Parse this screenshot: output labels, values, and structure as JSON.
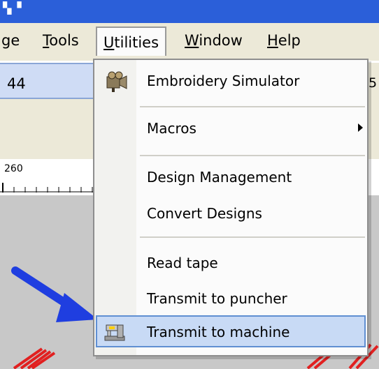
{
  "window": {
    "title_glyph": "▚▝"
  },
  "menubar": {
    "items": [
      {
        "label": "ge"
      },
      {
        "label": "Tools",
        "mnemonic": "T"
      },
      {
        "label": "Utilities",
        "mnemonic": "U",
        "open": true
      },
      {
        "label": "Window",
        "mnemonic": "W"
      },
      {
        "label": "Help",
        "mnemonic": "H"
      }
    ]
  },
  "toolbar": {
    "field_value": "44",
    "right_fragment": "5"
  },
  "ruler": {
    "number": "260"
  },
  "utilities_menu": {
    "items": [
      {
        "label": "Embroidery Simulator",
        "icon": "simulator-icon"
      },
      {
        "label": "Macros",
        "has_submenu": true
      },
      {
        "label": "Design Management"
      },
      {
        "label": "Convert Designs"
      },
      {
        "label": "Read tape"
      },
      {
        "label": "Transmit to puncher"
      },
      {
        "label": "Transmit to machine",
        "icon": "embroidery-machine-icon",
        "highlighted": true
      }
    ]
  },
  "colors": {
    "titlebar": "#2b5fd9",
    "menu_highlight": "#c8daf5",
    "highlight_border": "#5f8fd2",
    "annotation_arrow": "#1f3ee0",
    "embroidery_red": "#e12020"
  }
}
